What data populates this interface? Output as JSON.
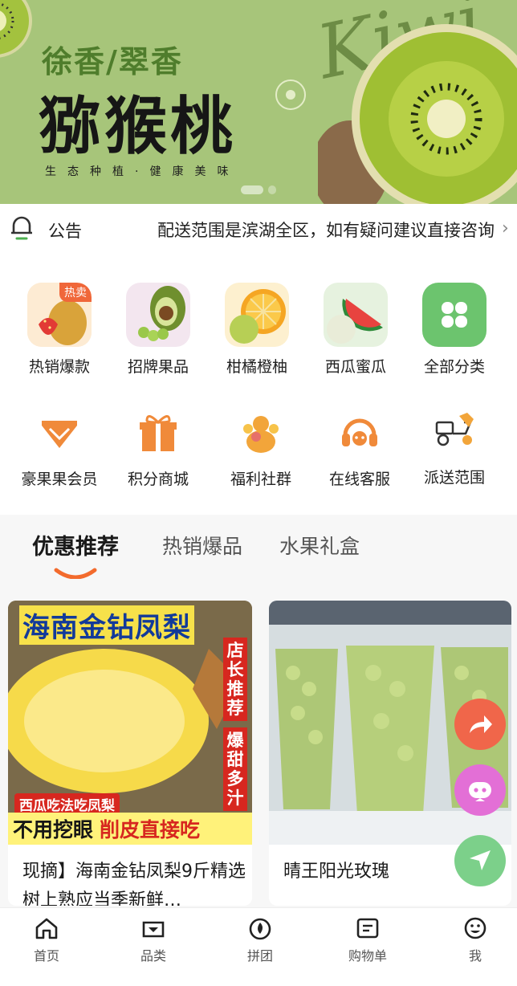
{
  "banner": {
    "subtitle": "徐香/翠香",
    "title": "猕猴桃",
    "slogan": "生态种植·健康美味",
    "script_word": "Kiwi"
  },
  "notice": {
    "label": "公告",
    "message": "配送范围是滨湖全区，如有疑问建议直接咨询"
  },
  "categories_row1": [
    {
      "label": "热销爆款",
      "badge": "热卖",
      "icon": "fruit-basket-icon"
    },
    {
      "label": "招牌果品",
      "icon": "avocado-icon"
    },
    {
      "label": "柑橘橙柚",
      "icon": "orange-icon"
    },
    {
      "label": "西瓜蜜瓜",
      "icon": "watermelon-icon"
    },
    {
      "label": "全部分类",
      "icon": "clover-icon"
    }
  ],
  "categories_row2": [
    {
      "label": "豪果果会员",
      "icon": "diamond-icon"
    },
    {
      "label": "积分商城",
      "icon": "gift-icon"
    },
    {
      "label": "福利社群",
      "icon": "group-icon"
    },
    {
      "label": "在线客服",
      "icon": "headset-icon"
    },
    {
      "label": "派送范围",
      "icon": "scooter-icon"
    }
  ],
  "tabs": [
    {
      "label": "优惠推荐",
      "active": true
    },
    {
      "label": "热销爆品",
      "active": false
    },
    {
      "label": "水果礼盒",
      "active": false
    }
  ],
  "products": [
    {
      "title": "现摘】海南金钻凤梨9斤精选树上熟应当季新鲜…",
      "img_top": "海南金钻凤梨",
      "img_side": "店长推荐",
      "img_side2": "爆甜多汁",
      "img_mid": "西瓜吃法吃凤梨",
      "img_bottom_a": "不用挖眼",
      "img_bottom_b": "削皮直接吃"
    },
    {
      "title": "晴王阳光玫瑰"
    }
  ],
  "nav": [
    {
      "label": "首页",
      "icon": "home-icon"
    },
    {
      "label": "品类",
      "icon": "category-icon"
    },
    {
      "label": "拼团",
      "icon": "group-buy-icon"
    },
    {
      "label": "购物单",
      "icon": "shopping-list-icon"
    },
    {
      "label": "我",
      "icon": "profile-icon"
    }
  ],
  "colors": {
    "accent": "#f08a3a",
    "banner_bg": "#a7c57a",
    "kiwi_green": "#8bb43a"
  }
}
